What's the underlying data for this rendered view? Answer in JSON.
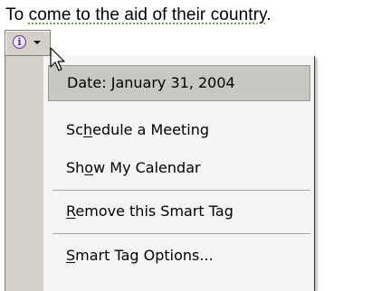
{
  "document": {
    "text_before": "To ",
    "tagged_text": "come to the aid of their country",
    "text_after": "."
  },
  "smart_tag_button": {
    "info_glyph": "i",
    "icon": "info-icon",
    "dropdown_icon": "chevron-down-icon"
  },
  "menu": {
    "header": "Date: January 31, 2004",
    "items": [
      {
        "before": "Sc",
        "mnemonic": "h",
        "after": "edule a Meeting"
      },
      {
        "before": "Sh",
        "mnemonic": "o",
        "after": "w My Calendar"
      },
      {
        "before": "",
        "mnemonic": "R",
        "after": "emove this Smart Tag"
      },
      {
        "before": "",
        "mnemonic": "S",
        "after": "mart Tag Options..."
      }
    ]
  },
  "colors": {
    "smart_tag_underline": "#6fa640",
    "menu_background": "#f5f5f3",
    "gutter": "#d4d0c8",
    "highlight": "#c9c7c2"
  }
}
